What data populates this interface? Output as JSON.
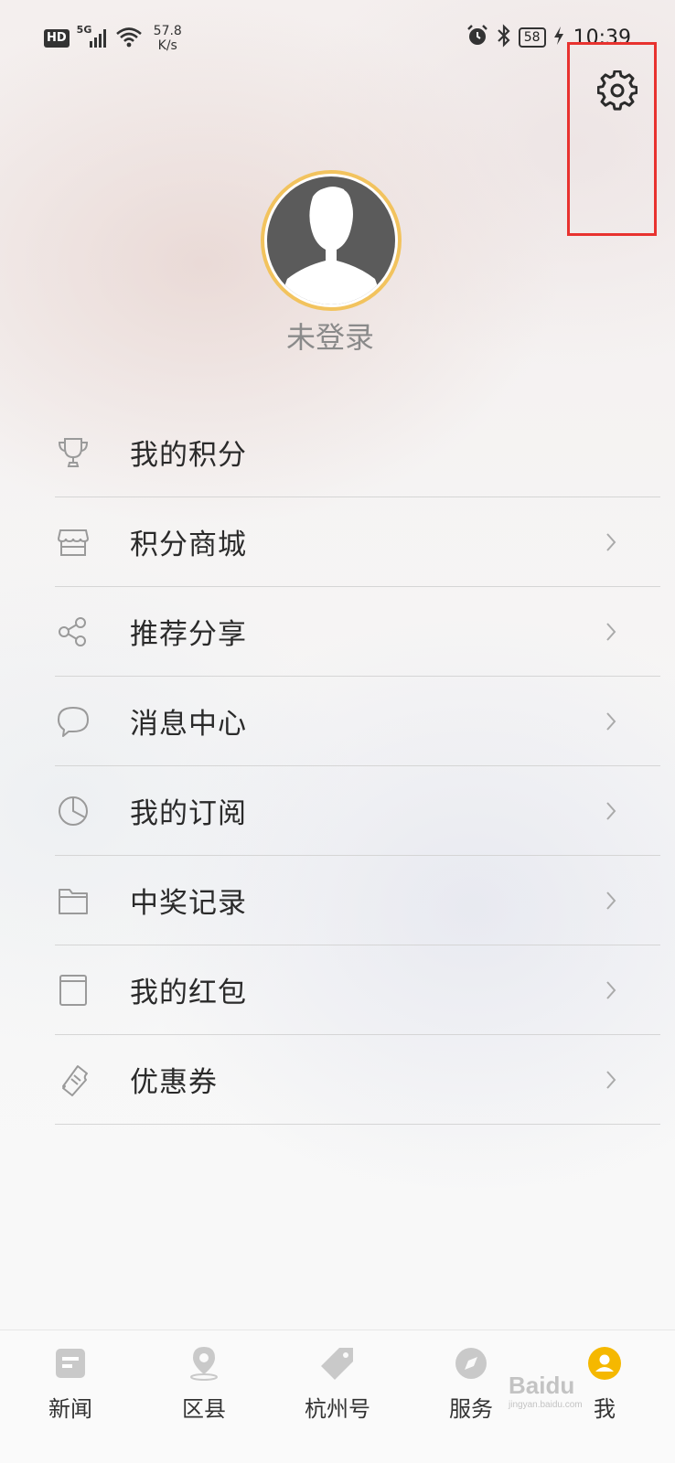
{
  "status_bar": {
    "hd": "HD",
    "network": "5G",
    "speed_value": "57.8",
    "speed_unit": "K/s",
    "battery": "58",
    "time": "10:39"
  },
  "profile": {
    "login_status": "未登录"
  },
  "menu": {
    "items": [
      {
        "label": "我的积分",
        "icon": "trophy-icon",
        "has_arrow": false
      },
      {
        "label": "积分商城",
        "icon": "store-icon",
        "has_arrow": true
      },
      {
        "label": "推荐分享",
        "icon": "share-icon",
        "has_arrow": true
      },
      {
        "label": "消息中心",
        "icon": "chat-bubble-icon",
        "has_arrow": true
      },
      {
        "label": "我的订阅",
        "icon": "pie-chart-icon",
        "has_arrow": true
      },
      {
        "label": "中奖记录",
        "icon": "folder-icon",
        "has_arrow": true
      },
      {
        "label": "我的红包",
        "icon": "red-envelope-icon",
        "has_arrow": true
      },
      {
        "label": "优惠券",
        "icon": "coupon-icon",
        "has_arrow": true
      }
    ]
  },
  "tab_bar": {
    "tabs": [
      {
        "label": "新闻",
        "icon": "news-icon"
      },
      {
        "label": "区县",
        "icon": "location-pin-icon"
      },
      {
        "label": "杭州号",
        "icon": "tag-icon"
      },
      {
        "label": "服务",
        "icon": "compass-icon"
      },
      {
        "label": "我",
        "icon": "user-icon",
        "active": true
      }
    ]
  },
  "watermark": {
    "brand": "Baidu",
    "site": "jingyan.baidu.com"
  },
  "colors": {
    "accent": "#f5b800",
    "highlight_box": "#e8322f",
    "avatar_border": "#f2c35e",
    "icon_gray": "#9a9a9a"
  }
}
